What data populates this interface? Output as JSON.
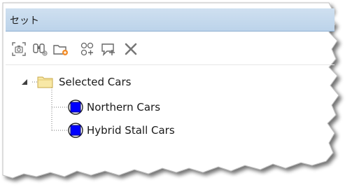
{
  "window": {
    "title": "セット"
  },
  "toolbar": {
    "buttons": [
      {
        "icon": "camera-frame-icon"
      },
      {
        "icon": "binoculars-icon"
      },
      {
        "icon": "new-folder-icon"
      },
      {
        "icon": "add-node-icon"
      },
      {
        "icon": "comment-add-icon"
      },
      {
        "icon": "delete-x-icon"
      }
    ]
  },
  "tree": {
    "root": {
      "label": "Selected Cars",
      "expanded": true,
      "icon": "folder-icon"
    },
    "children": [
      {
        "label": "Northern Cars",
        "icon": "set-icon"
      },
      {
        "label": "Hybrid Stall Cars",
        "icon": "set-icon"
      }
    ]
  },
  "colors": {
    "title_bg": "#c4d8ec",
    "set_icon_fill": "#0000ff",
    "folder_fill": "#f8e8a6"
  }
}
